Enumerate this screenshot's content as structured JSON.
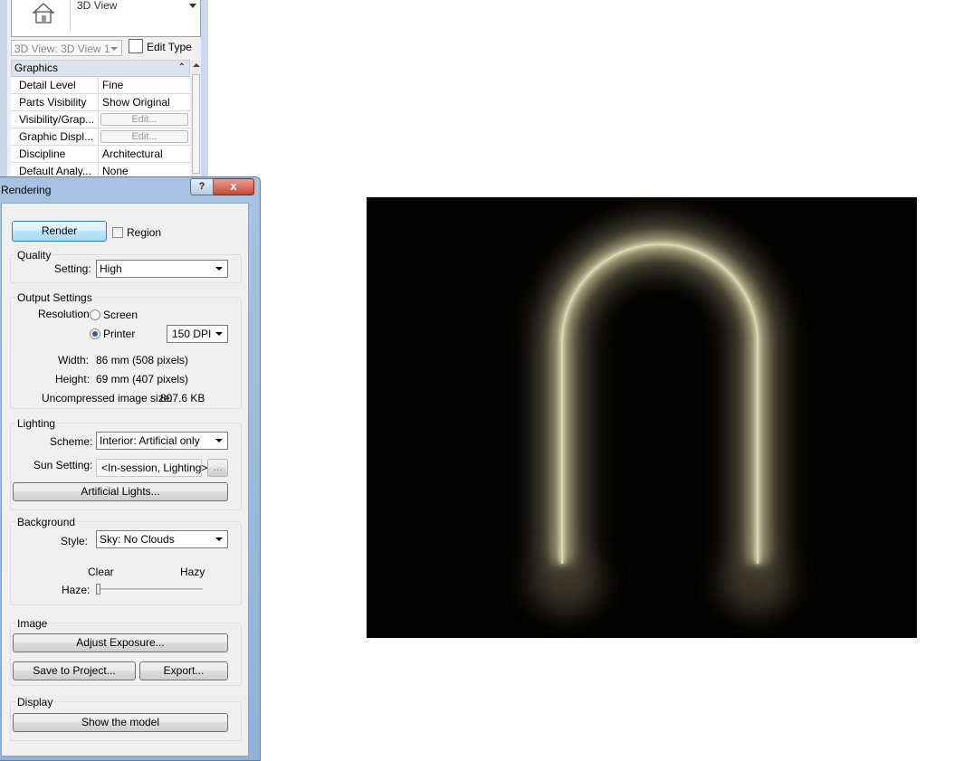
{
  "properties": {
    "type_name": "3D View",
    "view_selector": "3D View: 3D View 1",
    "edit_type_label": "Edit Type",
    "group": "Graphics",
    "rows": [
      {
        "key": "Detail Level",
        "value": "Fine"
      },
      {
        "key": "Parts Visibility",
        "value": "Show Original"
      },
      {
        "key": "Visibility/Grap...",
        "value": "Edit..."
      },
      {
        "key": "Graphic Displ...",
        "value": "Edit..."
      },
      {
        "key": "Discipline",
        "value": "Architectural"
      },
      {
        "key": "Default Analy...",
        "value": "None"
      }
    ]
  },
  "dialog": {
    "title": "Rendering",
    "help_label": "?",
    "close_label": "x",
    "render_button": "Render",
    "region_label": "Region",
    "region_checked": false,
    "quality": {
      "group_label": "Quality",
      "setting_label": "Setting:",
      "setting_value": "High"
    },
    "output": {
      "group_label": "Output Settings",
      "resolution_label": "Resolution:",
      "screen_label": "Screen",
      "printer_label": "Printer",
      "selected": "Printer",
      "dpi_value": "150 DPI",
      "width_label": "Width:",
      "width_value": "86 mm (508 pixels)",
      "height_label": "Height:",
      "height_value": "69 mm (407 pixels)",
      "size_label": "Uncompressed image size:",
      "size_value": "807.6 KB"
    },
    "lighting": {
      "group_label": "Lighting",
      "scheme_label": "Scheme:",
      "scheme_value": "Interior: Artificial only",
      "sun_label": "Sun Setting:",
      "sun_value": "<In-session, Lighting>",
      "sun_browse": "...",
      "artificial_button": "Artificial Lights..."
    },
    "background": {
      "group_label": "Background",
      "style_label": "Style:",
      "style_value": "Sky: No Clouds",
      "clear_label": "Clear",
      "hazy_label": "Hazy",
      "haze_label": "Haze:",
      "haze_level": 0
    },
    "image": {
      "group_label": "Image",
      "adjust_button": "Adjust Exposure...",
      "save_button": "Save to Project...",
      "export_button": "Export..."
    },
    "display": {
      "group_label": "Display",
      "show_model_button": "Show the model"
    }
  },
  "colors": {
    "render_background": "#020202",
    "arch_light": "#cfc7a2",
    "dialog_frame": "#a6c3e3",
    "close_button": "#c24a36"
  }
}
